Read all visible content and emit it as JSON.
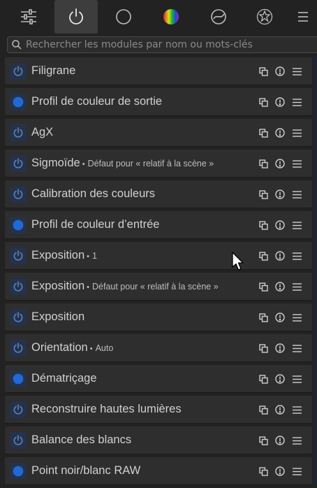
{
  "tabs": [
    {
      "name": "quick-access",
      "icon": "sliders-icon",
      "active": false
    },
    {
      "name": "active-modules",
      "icon": "power-icon",
      "active": true
    },
    {
      "name": "base",
      "icon": "circle-icon",
      "active": false
    },
    {
      "name": "color",
      "icon": "color-ball-icon",
      "active": false
    },
    {
      "name": "correct",
      "icon": "correct-circle-icon",
      "active": false
    },
    {
      "name": "effects",
      "icon": "effects-icon",
      "active": false
    },
    {
      "name": "menu",
      "icon": "hamburger-icon",
      "active": false
    }
  ],
  "search": {
    "placeholder": "Rechercher les modules par nom ou mots-clés",
    "value": ""
  },
  "colors": {
    "accent_on": "#1f6ad6",
    "accent_off": "#5b7fb8",
    "panel": "#2e2e2e"
  },
  "modules": [
    {
      "title": "Filigrane",
      "sep": "",
      "subtitle": "",
      "enabled": false
    },
    {
      "title": "Profil de couleur de sortie",
      "sep": "",
      "subtitle": "",
      "enabled": true
    },
    {
      "title": "AgX",
      "sep": "",
      "subtitle": "",
      "enabled": false
    },
    {
      "title": "Sigmoïde",
      "sep": "•",
      "subtitle": "Défaut pour « relatif à la scène »",
      "enabled": false
    },
    {
      "title": "Calibration des couleurs",
      "sep": "",
      "subtitle": "",
      "enabled": false
    },
    {
      "title": "Profil de couleur d’entrée",
      "sep": "",
      "subtitle": "",
      "enabled": true
    },
    {
      "title": "Exposition",
      "sep": "•",
      "subtitle": "1",
      "enabled": false
    },
    {
      "title": "Exposition",
      "sep": "•",
      "subtitle": "Défaut pour « relatif à la scène »",
      "enabled": false
    },
    {
      "title": "Exposition",
      "sep": "",
      "subtitle": "",
      "enabled": false
    },
    {
      "title": "Orientation",
      "sep": "•",
      "subtitle": "Auto",
      "enabled": false
    },
    {
      "title": "Dématriçage",
      "sep": "",
      "subtitle": "",
      "enabled": true
    },
    {
      "title": "Reconstruire hautes lumières",
      "sep": "",
      "subtitle": "",
      "enabled": false
    },
    {
      "title": "Balance des blancs",
      "sep": "",
      "subtitle": "",
      "enabled": false
    },
    {
      "title": "Point noir/blanc RAW",
      "sep": "",
      "subtitle": "",
      "enabled": true
    }
  ]
}
